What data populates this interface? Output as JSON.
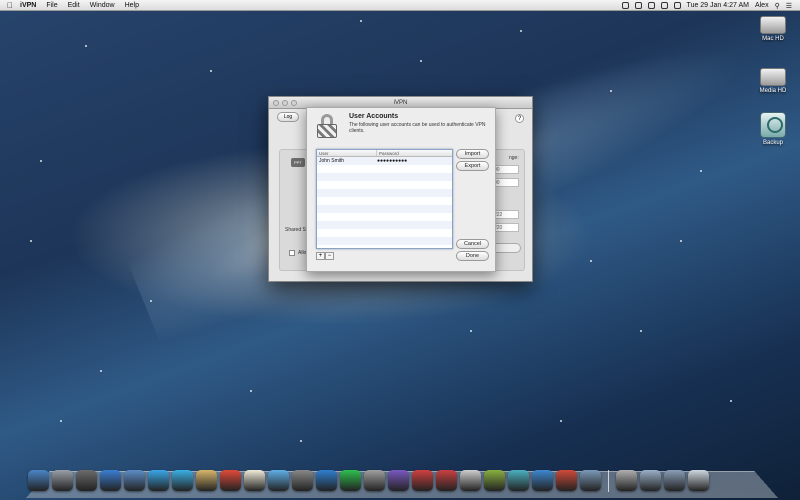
{
  "menubar": {
    "apple": "",
    "items": [
      "iVPN",
      "File",
      "Edit",
      "Window",
      "Help"
    ],
    "clock": "Tue 29 Jan  4:27 AM",
    "user": "Alex"
  },
  "desktop": {
    "icons": [
      {
        "label": "Mac HD"
      },
      {
        "label": "Media HD"
      },
      {
        "label": "Backup"
      }
    ]
  },
  "window": {
    "title": "iVPN",
    "log_button": "Log",
    "help": "?",
    "background": {
      "tab": "PPT",
      "nge_label": "nge:",
      "field1": "00",
      "field2": "00",
      "field3": "222",
      "field4": "220",
      "shared_label": "Shared S",
      "allow_label": "Allo"
    }
  },
  "sheet": {
    "title": "User Accounts",
    "description": "The following user accounts can be used to authenticate VPN clients.",
    "table": {
      "columns": [
        "User",
        "Password"
      ],
      "rows": [
        [
          "John Smith",
          "●●●●●●●●●●"
        ],
        [
          "",
          ""
        ],
        [
          "",
          ""
        ],
        [
          "",
          ""
        ],
        [
          "",
          ""
        ],
        [
          "",
          ""
        ],
        [
          "",
          ""
        ],
        [
          "",
          ""
        ],
        [
          "",
          ""
        ],
        [
          "",
          ""
        ],
        [
          "",
          ""
        ]
      ]
    },
    "buttons": {
      "import": "Import",
      "export": "Export",
      "cancel": "Cancel",
      "done": "Done",
      "add": "+",
      "remove": "−"
    }
  },
  "dock": {
    "colors": [
      "#4a86c8",
      "#9aa0a8",
      "#6b6b6b",
      "#3b7fd4",
      "#5c8ec8",
      "#3aa6e8",
      "#3bb0e6",
      "#d8b56b",
      "#e04a3a",
      "#f0ecd8",
      "#5fb0e8",
      "#888888",
      "#2f7fd0",
      "#2fbf4f",
      "#a0a0a0",
      "#7a58c0",
      "#d04040",
      "#c84040",
      "#cfcfcf",
      "#8ab040",
      "#4ab0c0",
      "#3e88d0",
      "#d04a3a",
      "#7a9ab8",
      "#b0b0b0",
      "#9ab0c8",
      "#8a9fb8",
      "#cfd8e0"
    ]
  }
}
